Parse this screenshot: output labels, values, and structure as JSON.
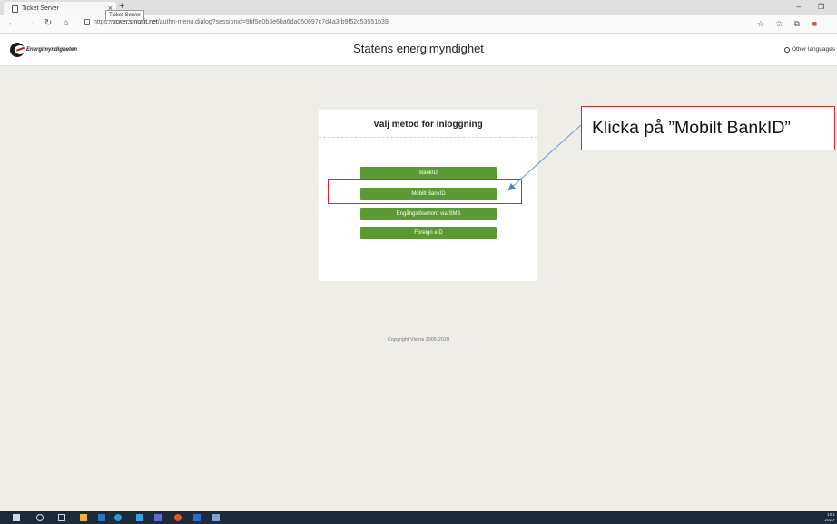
{
  "browser": {
    "tab_title": "Ticket Server",
    "tab_close": "×",
    "tooltip": "Ticket Server",
    "new_tab": "+",
    "url_prefix": "https://",
    "url_host": "ticket.siriusit.net",
    "url_rest": "/authn-menu.dialog?sessionid=9bf5e0b3e6ba6da050697c7d4a3fb9f52c53551b39",
    "back": "←",
    "forward": "→",
    "reload": "↻",
    "home": "⌂",
    "minimize": "–",
    "restore": "❐",
    "star": "☆",
    "favorites": "✩",
    "collections": "⧉",
    "more": "···"
  },
  "header": {
    "logo_text": "Energimyndigheten",
    "title": "Statens energimyndighet",
    "other_languages": "Other languages"
  },
  "login": {
    "title": "Välj metod för inloggning",
    "methods": [
      "BankID",
      "Mobilt BankID",
      "Engångslösenord via SMS",
      "Foreign eID"
    ]
  },
  "footer": {
    "copyright": "Copyright Visma 2005-2020"
  },
  "annotation": {
    "callout_text": "Klicka på ”Mobilt BankID”",
    "color": "#e0262a"
  },
  "taskbar": {
    "time": "10:1",
    "date": "2020-"
  }
}
